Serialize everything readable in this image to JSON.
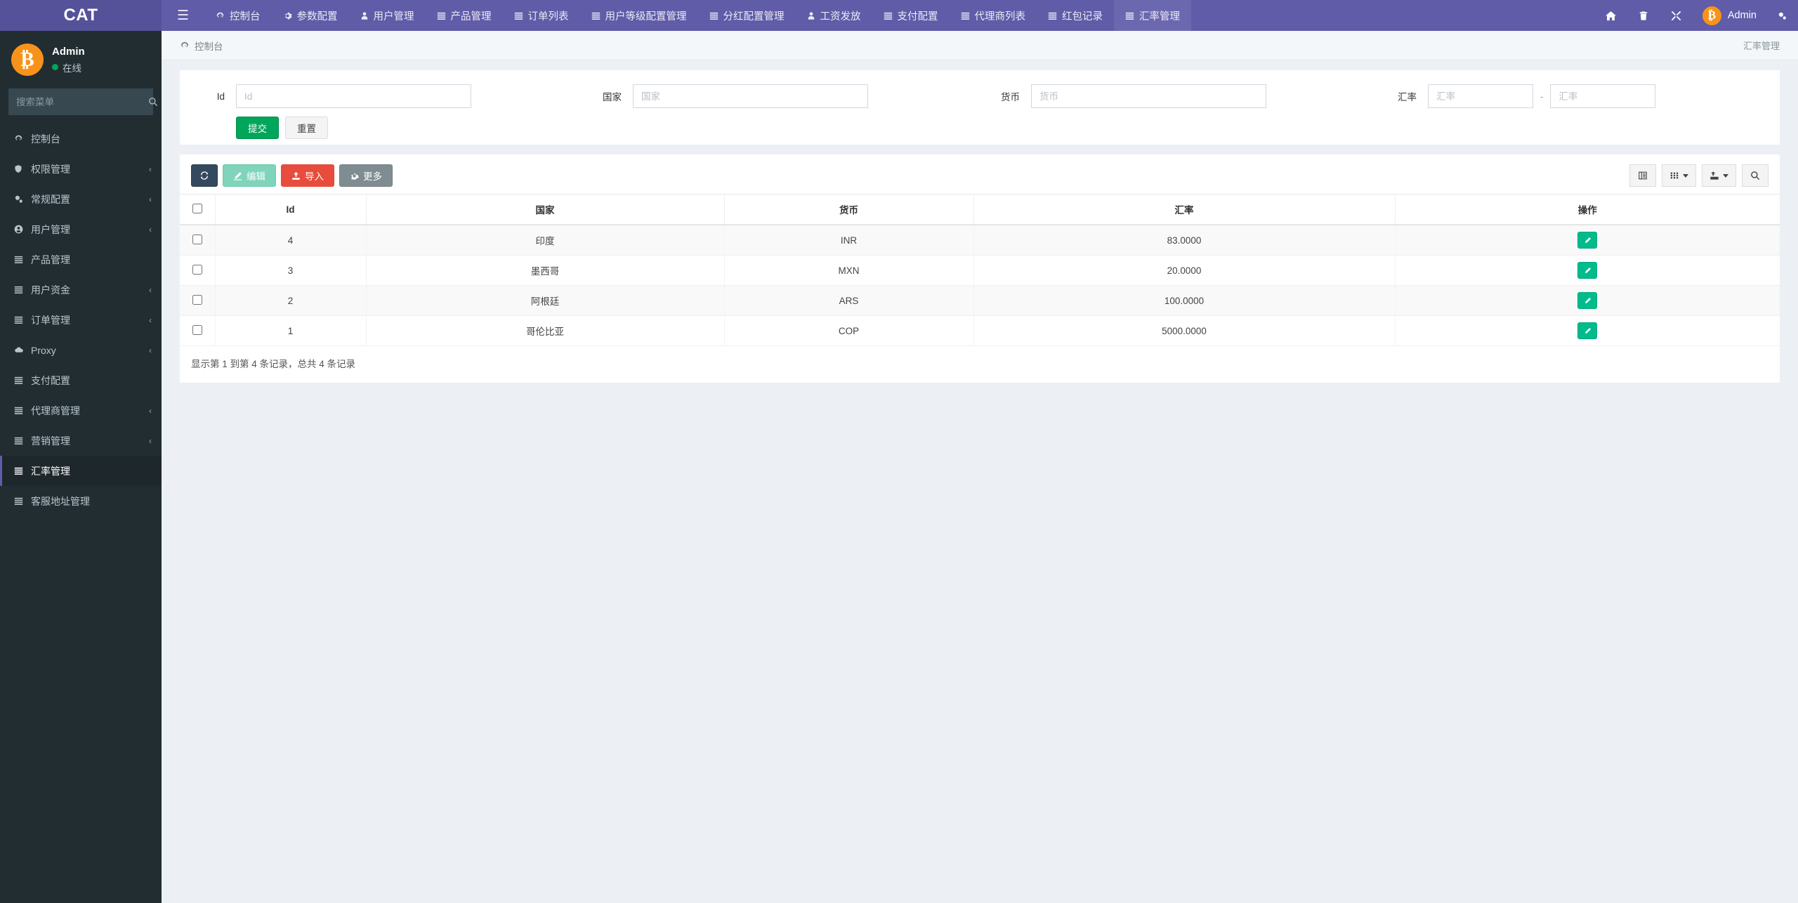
{
  "brand": {
    "title": "CAT"
  },
  "topnav": {
    "menu_icon": "hamburger-icon",
    "items": [
      {
        "label": "控制台",
        "icon": "dashboard-icon",
        "active": false
      },
      {
        "label": "参数配置",
        "icon": "gear-icon",
        "active": false
      },
      {
        "label": "用户管理",
        "icon": "user-icon",
        "active": false
      },
      {
        "label": "产品管理",
        "icon": "list-icon",
        "active": false
      },
      {
        "label": "订单列表",
        "icon": "list-icon",
        "active": false
      },
      {
        "label": "用户等级配置管理",
        "icon": "list-icon",
        "active": false
      },
      {
        "label": "分红配置管理",
        "icon": "list-icon",
        "active": false
      },
      {
        "label": "工资发放",
        "icon": "user-icon",
        "active": false
      },
      {
        "label": "支付配置",
        "icon": "list-icon",
        "active": false
      },
      {
        "label": "代理商列表",
        "icon": "list-icon",
        "active": false
      },
      {
        "label": "红包记录",
        "icon": "list-icon",
        "active": false
      },
      {
        "label": "汇率管理",
        "icon": "list-icon",
        "active": true
      }
    ],
    "right_icons": [
      "home-icon",
      "trash-icon",
      "fullscreen-icon"
    ],
    "user_label": "Admin",
    "settings_icon": "cogs-icon"
  },
  "sidebar": {
    "profile": {
      "name": "Admin",
      "status": "在线"
    },
    "search": {
      "placeholder": "搜索菜单",
      "value": "",
      "icon": "search-icon"
    },
    "items": [
      {
        "label": "控制台",
        "icon": "dashboard-icon",
        "caret": false,
        "active": false
      },
      {
        "label": "权限管理",
        "icon": "shield-icon",
        "caret": true,
        "active": false
      },
      {
        "label": "常规配置",
        "icon": "cogs-icon",
        "caret": true,
        "active": false
      },
      {
        "label": "用户管理",
        "icon": "user-circle-icon",
        "caret": true,
        "active": false
      },
      {
        "label": "产品管理",
        "icon": "list-icon",
        "caret": false,
        "active": false
      },
      {
        "label": "用户资金",
        "icon": "list-icon",
        "caret": true,
        "active": false
      },
      {
        "label": "订单管理",
        "icon": "list-icon",
        "caret": true,
        "active": false
      },
      {
        "label": "Proxy",
        "icon": "cloud-icon",
        "caret": true,
        "active": false
      },
      {
        "label": "支付配置",
        "icon": "list-icon",
        "caret": false,
        "active": false
      },
      {
        "label": "代理商管理",
        "icon": "list-icon",
        "caret": true,
        "active": false
      },
      {
        "label": "营销管理",
        "icon": "list-icon",
        "caret": true,
        "active": false
      },
      {
        "label": "汇率管理",
        "icon": "list-icon",
        "caret": false,
        "active": true
      },
      {
        "label": "客服地址管理",
        "icon": "list-icon",
        "caret": false,
        "active": false
      }
    ]
  },
  "breadcrumb": {
    "icon": "dashboard-icon",
    "label": "控制台",
    "right_label": "汇率管理"
  },
  "filter": {
    "id": {
      "label": "Id",
      "placeholder": "Id",
      "value": ""
    },
    "country": {
      "label": "国家",
      "placeholder": "国家",
      "value": ""
    },
    "currency": {
      "label": "货币",
      "placeholder": "货币",
      "value": ""
    },
    "rate": {
      "label": "汇率",
      "min_placeholder": "汇率",
      "min_value": "",
      "separator": "-",
      "max_placeholder": "汇率",
      "max_value": ""
    },
    "submit_label": "提交",
    "reset_label": "重置"
  },
  "toolbar": {
    "refresh_icon": "refresh-icon",
    "edit_label": "编辑",
    "edit_icon": "pencil-icon",
    "import_label": "导入",
    "import_icon": "upload-icon",
    "more_label": "更多",
    "more_icon": "gear-icon",
    "view_icon": "table-view-icon",
    "columns_icon": "columns-grid-icon",
    "export_icon": "export-icon",
    "search_icon": "search-icon"
  },
  "table": {
    "headers": [
      "Id",
      "国家",
      "货币",
      "汇率",
      "操作"
    ],
    "rows": [
      {
        "id": "4",
        "country": "印度",
        "currency": "INR",
        "rate": "83.0000"
      },
      {
        "id": "3",
        "country": "墨西哥",
        "currency": "MXN",
        "rate": "20.0000"
      },
      {
        "id": "2",
        "country": "阿根廷",
        "currency": "ARS",
        "rate": "100.0000"
      },
      {
        "id": "1",
        "country": "哥伦比亚",
        "currency": "COP",
        "rate": "5000.0000"
      }
    ],
    "row_action_icon": "pencil-icon",
    "footer": "显示第 1 到第 4 条记录，总共 4 条记录"
  },
  "colors": {
    "topbar": "#605ca8",
    "brand": "#555299",
    "sidebar": "#222d32",
    "accent_green": "#00a65a",
    "edit_teal": "#00bc8c",
    "import_red": "#e74c3c",
    "bitcoin_orange": "#f7931a"
  }
}
